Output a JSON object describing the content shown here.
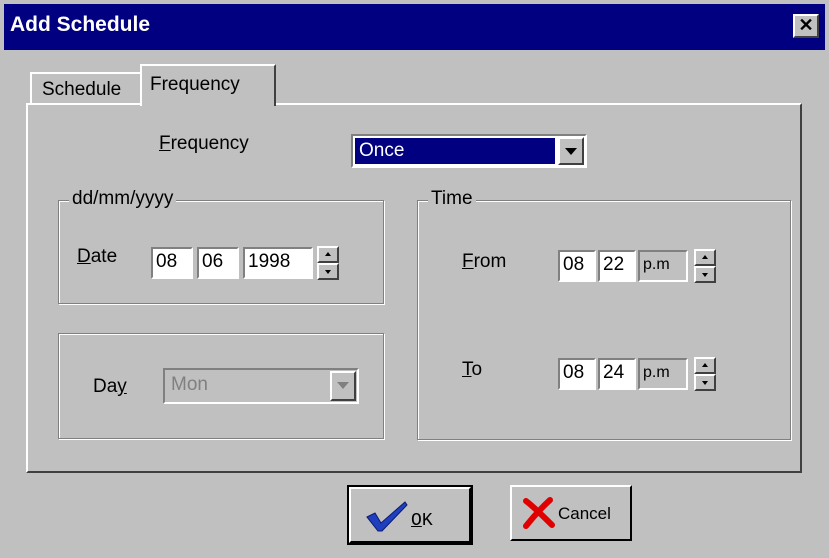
{
  "window": {
    "title": "Add Schedule",
    "close_label": "✕"
  },
  "tabs": [
    {
      "label": "Schedule",
      "active": false
    },
    {
      "label": "Frequency",
      "active": true
    }
  ],
  "frequency": {
    "label_rest": "requency",
    "label_key": "F",
    "selected": "Once"
  },
  "date_group": {
    "legend": "dd/mm/yyyy",
    "label_key": "D",
    "label_rest": "ate",
    "day": "08",
    "month": "06",
    "year": "1998"
  },
  "day_group": {
    "label_pre": "Da",
    "label_key": "y",
    "selected": "Mon",
    "enabled": false
  },
  "time_group": {
    "legend": "Time",
    "from": {
      "label_key": "F",
      "label_rest": "rom",
      "hour": "08",
      "minute": "22",
      "ampm": "p.m"
    },
    "to": {
      "label_key": "T",
      "label_rest": "o",
      "hour": "08",
      "minute": "24",
      "ampm": "p.m"
    }
  },
  "buttons": {
    "ok_key": "O",
    "ok_rest": "K",
    "cancel": "Cancel"
  },
  "colors": {
    "titlebar": "#000080",
    "face": "#c0c0c0",
    "checkmark": "#1f3fbf",
    "cross": "#e00000"
  }
}
